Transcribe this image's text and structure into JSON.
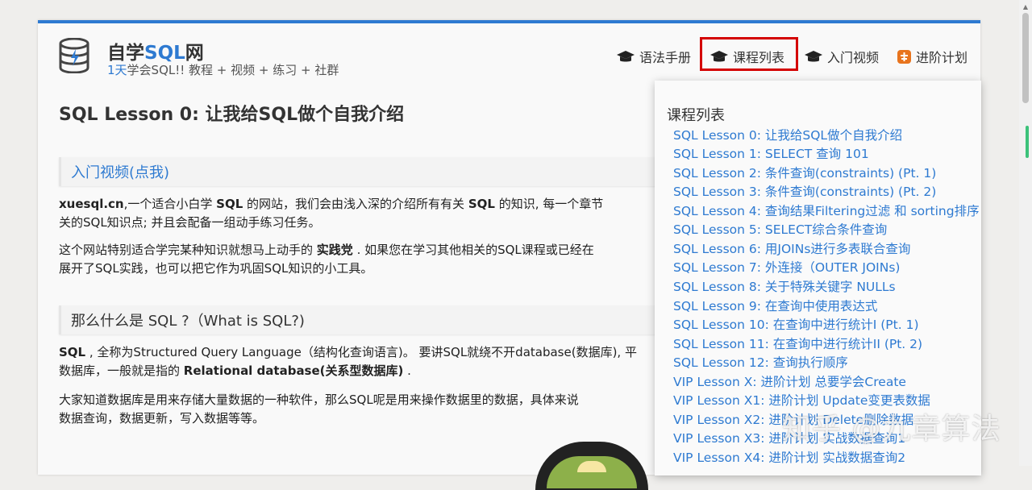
{
  "brand": {
    "name_prefix": "自学",
    "name_sql": "SQL",
    "name_suffix": "网",
    "tagline_accent": "1天",
    "tagline_rest": "学会SQL!! 教程 + 视频 + 练习 + 社群"
  },
  "nav": {
    "items": [
      "语法手册",
      "课程列表",
      "入门视频",
      "进阶计划"
    ]
  },
  "main": {
    "title": "SQL Lesson 0: 让我给SQL做个自我介绍",
    "video_link": "入门视频(点我)",
    "p1": {
      "b1": "xuesql.cn",
      "t1": ",一个适合小白学 ",
      "b2": "SQL",
      "t2": " 的网站，我们会由浅入深的介绍所有有关 ",
      "b3": "SQL",
      "t3": " 的知识, 每一个章节",
      "line2": "关的SQL知识点; 并且会配备一组动手练习任务。"
    },
    "p2": {
      "t1": "这个网站特别适合学完某种知识就想马上动手的 ",
      "b1": "实践党",
      "t2": " . 如果您在学习其他相关的SQL课程或已经在",
      "line2": "展开了SQL实践，也可以把它作为巩固SQL知识的小工具。"
    },
    "section2": "那么什么是 SQL ?（What is SQL?)",
    "p3": {
      "b1": "SQL",
      "t1": " , 全称为Structured Query Language（结构化查询语言)。 要讲SQL就绕不开database(数据库), 平",
      "t2": "数据库，一般就是指的 ",
      "b2": "Relational database(关系型数据库)",
      "t3": " ."
    },
    "p4": {
      "line1": "大家知道数据库是用来存储大量数据的一种软件，那么SQL呢是用来操作数据里的数据，具体来说",
      "line2": "数据查询，数据更新，写入数据等等。"
    }
  },
  "dropdown": {
    "title": "课程列表",
    "items": [
      "SQL Lesson 0: 让我给SQL做个自我介绍",
      "SQL Lesson 1: SELECT 查询 101",
      "SQL Lesson 2: 条件查询(constraints) (Pt. 1)",
      "SQL Lesson 3: 条件查询(constraints) (Pt. 2)",
      "SQL Lesson 4: 查询结果Filtering过滤 和 sorting排序",
      "SQL Lesson 5: SELECT综合条件查询",
      "SQL Lesson 6: 用JOINs进行多表联合查询",
      "SQL Lesson 7: 外连接（OUTER JOINs)",
      "SQL Lesson 8: 关于特殊关键字 NULLs",
      "SQL Lesson 9: 在查询中使用表达式",
      "SQL Lesson 10: 在查询中进行统计I (Pt. 1)",
      "SQL Lesson 11: 在查询中进行统计II (Pt. 2)",
      "SQL Lesson 12: 查询执行顺序",
      "VIP Lesson X: 进阶计划 总要学会Create",
      "VIP Lesson X1: 进阶计划 Update变更表数据",
      "VIP Lesson X2: 进阶计划 Delete删除数据",
      "VIP Lesson X3: 进阶计划 实战数据查询1",
      "VIP Lesson X4: 进阶计划 实战数据查询2"
    ]
  },
  "watermark": "知乎 @九章算法",
  "colors": {
    "accent": "#2e7ad1",
    "highlight_border": "#d40000",
    "top_bar": "#2e7ad1"
  }
}
